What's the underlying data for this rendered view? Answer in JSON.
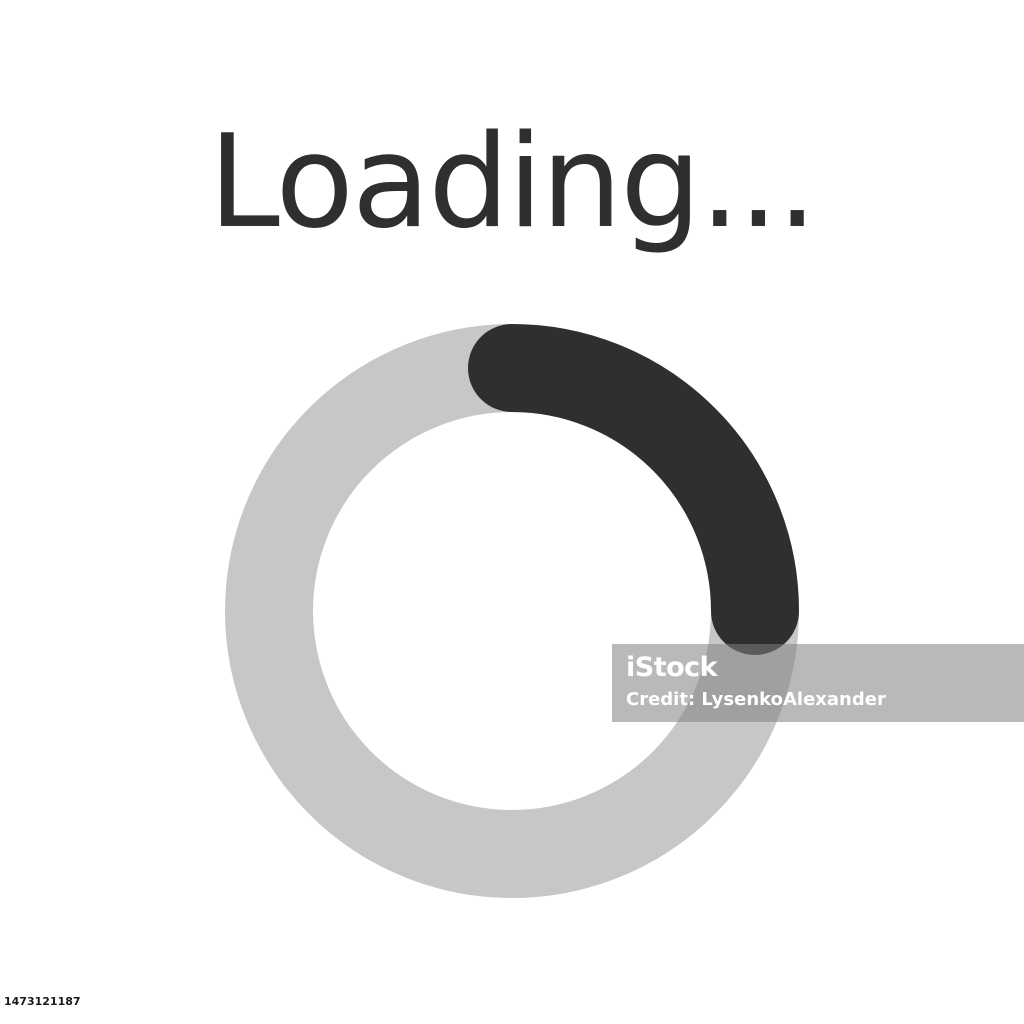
{
  "title": "Loading...",
  "spinner": {
    "progress_fraction": 0.25,
    "track_color": "#c6c7c6",
    "arc_color": "#2d2f31"
  },
  "watermark": {
    "logo_text": "iStock",
    "credit_text": "Credit: LysenkoAlexander"
  },
  "image_id": "1473121187"
}
